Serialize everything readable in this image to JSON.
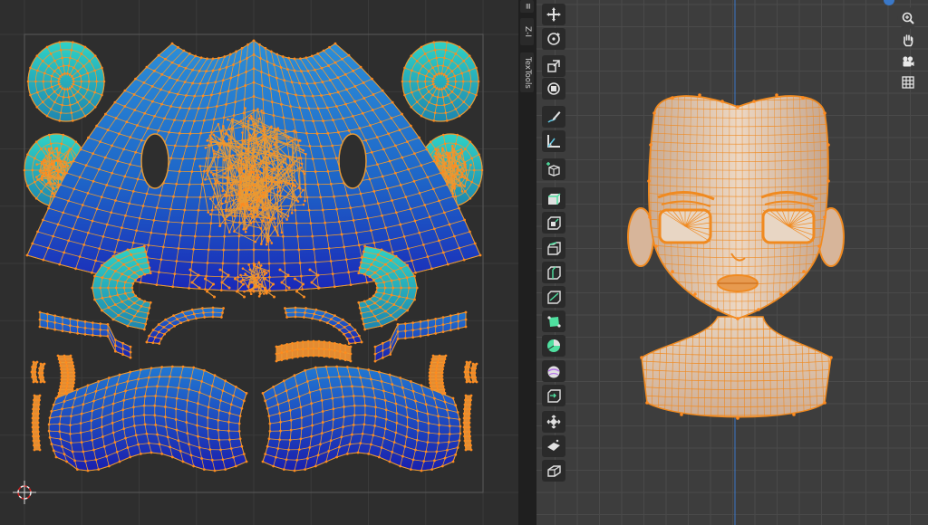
{
  "sidebar_tabs": [
    {
      "id": "tab-tool",
      "label": "≡"
    },
    {
      "id": "tab-view",
      "label": "Z‑I"
    },
    {
      "id": "tab-textools",
      "label": "TexTools"
    }
  ],
  "toolbar": {
    "tools": [
      {
        "name": "move-tool-icon",
        "glyph": "move"
      },
      {
        "name": "rotate-tool-icon",
        "glyph": "rotate"
      },
      {
        "name": "scale-tool-icon",
        "glyph": "scale"
      },
      {
        "name": "transform-tool-icon",
        "glyph": "transform"
      },
      {
        "name": "annotate-tool-icon",
        "glyph": "annotate"
      },
      {
        "name": "measure-tool-icon",
        "glyph": "measure"
      },
      {
        "name": "add-cube-tool-icon",
        "glyph": "addcube"
      },
      {
        "name": "extrude-tool-icon",
        "glyph": "extrude"
      },
      {
        "name": "inset-tool-icon",
        "glyph": "inset"
      },
      {
        "name": "bevel-tool-icon",
        "glyph": "bevel"
      },
      {
        "name": "loop-cut-tool-icon",
        "glyph": "loopcut"
      },
      {
        "name": "knife-tool-icon",
        "glyph": "knife"
      },
      {
        "name": "poly-build-tool-icon",
        "glyph": "polybuild"
      },
      {
        "name": "spin-tool-icon",
        "glyph": "spin"
      },
      {
        "name": "smooth-tool-icon",
        "glyph": "smooth"
      },
      {
        "name": "edge-slide-tool-icon",
        "glyph": "edgeslide"
      },
      {
        "name": "shrink-fatten-tool-icon",
        "glyph": "shrink"
      },
      {
        "name": "shear-tool-icon",
        "glyph": "shear"
      },
      {
        "name": "rip-region-tool-icon",
        "glyph": "rip"
      }
    ]
  },
  "nav_gizmo": [
    {
      "name": "zoom-icon"
    },
    {
      "name": "pan-hand-icon"
    },
    {
      "name": "camera-view-icon"
    },
    {
      "name": "ortho-grid-icon"
    }
  ],
  "colors": {
    "uv_background": "#2e2e2e",
    "uv_grid": "#3a3a3a",
    "uv_bounds": "#5a5a5a",
    "uv_island_light": "#1fb2b5",
    "uv_island_mid": "#1f6fd0",
    "uv_island_dark": "#1a24b5",
    "uv_edge": "#e89a35",
    "uv_vertex": "#ff8a1e",
    "viewport_background": "#3d3d3d",
    "viewport_grid": "#4a4a4a",
    "mesh_surface": "#ddc4ad",
    "mesh_wire": "#f08a20",
    "axis_line": "#3a78c8"
  }
}
